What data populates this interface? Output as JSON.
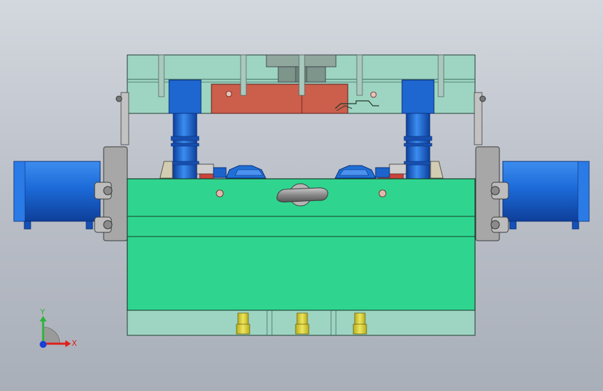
{
  "viewport": {
    "background_top": "#d3d7de",
    "background_bottom": "#a9afb9"
  },
  "colors": {
    "plate_teal": "#9ed4c2",
    "core_green": "#2fd58f",
    "cavity_red": "#cc5e4c",
    "cylinder_blue": "#1f6fd6",
    "clamp_gray": "#a7a7a7",
    "pin_yellow": "#d6d03a"
  },
  "triad": {
    "x_label": "X",
    "y_label": "Y",
    "x_color": "#e0201a",
    "y_color": "#2fb43a",
    "z_color": "#1a3fd6"
  }
}
